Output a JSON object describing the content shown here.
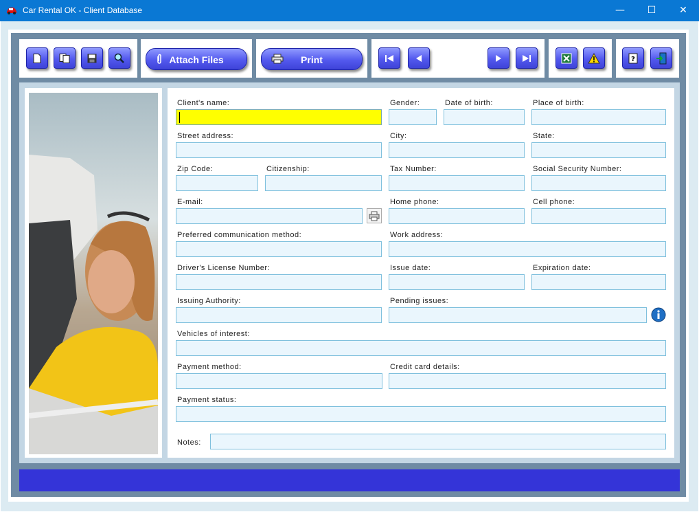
{
  "window": {
    "title": "Car Rental OK - Client Database",
    "controls": {
      "minimize": "—",
      "maximize": "☐",
      "close": "✕"
    }
  },
  "toolbar": {
    "new_icon": "new-document-icon",
    "copy_icon": "copy-icon",
    "save_icon": "save-icon",
    "search_icon": "search-icon",
    "attach_label": "Attach Files",
    "print_label": "Print",
    "nav_icons": [
      "first-record-icon",
      "previous-record-icon",
      "next-record-icon",
      "last-record-icon"
    ],
    "excel_icon": "excel-export-icon",
    "warning_icon": "warning-icon",
    "help_icon": "help-icon",
    "exit_icon": "exit-icon"
  },
  "colors": {
    "titlebar": "#0a78d4",
    "button": "#5359ee",
    "field_bg": "#eaf6fd",
    "active_field": "#ffff00",
    "status_bar": "#3434d8"
  },
  "form": {
    "client_name": "Client's name:",
    "gender": "Gender:",
    "date_of_birth": "Date of birth:",
    "place_of_birth": "Place of birth:",
    "street_address": "Street address:",
    "city": "City:",
    "state": "State:",
    "zip_code": "Zip Code:",
    "citizenship": "Citizenship:",
    "tax_number": "Tax Number:",
    "ssn": "Social Security Number:",
    "email": "E-mail:",
    "home_phone": "Home phone:",
    "cell_phone": "Cell phone:",
    "preferred_comm": "Preferred communication method:",
    "work_address": "Work address:",
    "license_number": "Driver's License Number:",
    "issue_date": "Issue date:",
    "expiration_date": "Expiration date:",
    "issuing_authority": "Issuing Authority:",
    "pending_issues": "Pending issues:",
    "vehicles_of_interest": "Vehicles of interest:",
    "payment_method": "Payment method:",
    "credit_card_details": "Credit card details:",
    "payment_status": "Payment status:",
    "notes": "Notes:"
  }
}
